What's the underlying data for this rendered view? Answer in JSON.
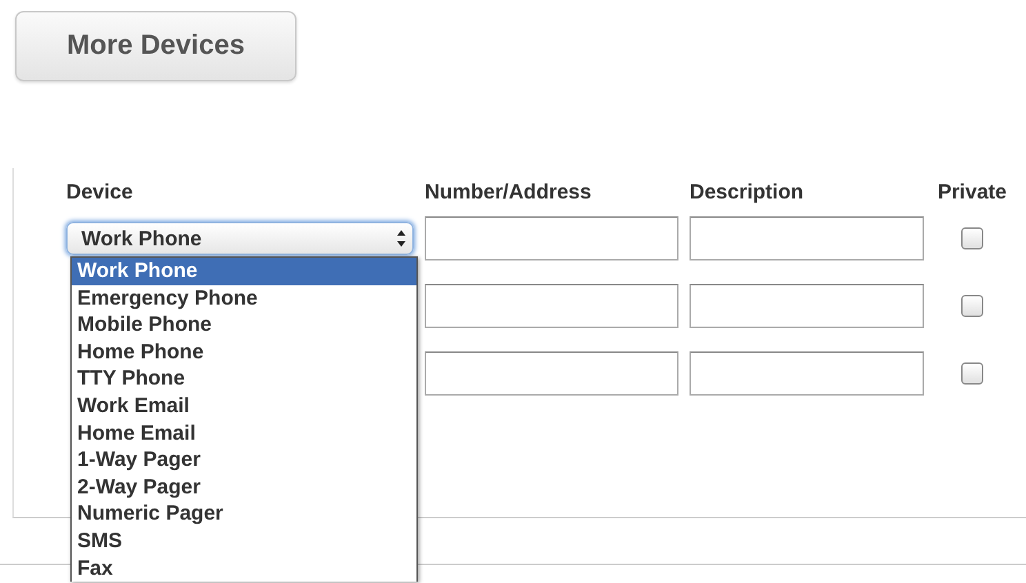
{
  "more_button": "More Devices",
  "columns": [
    "Device",
    "Number/Address",
    "Description",
    "Private"
  ],
  "rows": [
    {
      "device": "Work Phone",
      "private": false
    },
    {
      "private": false
    },
    {
      "private": false
    }
  ],
  "dropdown": {
    "open": true,
    "options": [
      {
        "label": "Work Phone",
        "selected": true
      },
      {
        "label": "Emergency Phone",
        "selected": false
      },
      {
        "label": "Mobile Phone",
        "selected": false
      },
      {
        "label": "Home Phone",
        "selected": false
      },
      {
        "label": "TTY Phone",
        "selected": false
      },
      {
        "label": "Work Email",
        "selected": false
      },
      {
        "label": "Home Email",
        "selected": false
      },
      {
        "label": "1-Way Pager",
        "selected": false
      },
      {
        "label": "2-Way Pager",
        "selected": false
      },
      {
        "label": "Numeric Pager",
        "selected": false
      },
      {
        "label": "SMS",
        "selected": false
      },
      {
        "label": "Fax",
        "selected": false
      }
    ]
  }
}
